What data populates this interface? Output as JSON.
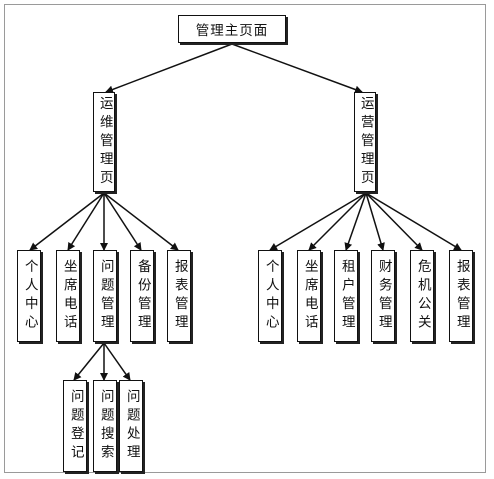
{
  "root": {
    "label": "管理主页面"
  },
  "ops": {
    "label": "运维管理页",
    "children": [
      "个人中心",
      "坐席电话",
      "问题管理",
      "备份管理",
      "报表管理"
    ],
    "issue_children": [
      "问题登记",
      "问题搜索",
      "问题处理"
    ]
  },
  "biz": {
    "label": "运营管理页",
    "children": [
      "个人中心",
      "坐席电话",
      "租户管理",
      "财务管理",
      "危机公关",
      "报表管理"
    ]
  }
}
